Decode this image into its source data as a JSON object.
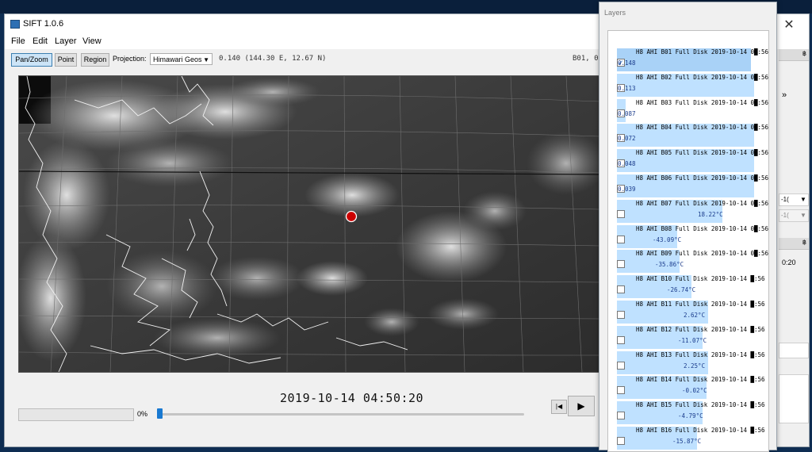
{
  "window": {
    "title": "SIFT 1.0.6",
    "close_glyph": "✕"
  },
  "menu": [
    "File",
    "Edit",
    "Layer",
    "View"
  ],
  "toolbar": {
    "tools": [
      "Pan/Zoom",
      "Point",
      "Region"
    ],
    "active_tool": "Pan/Zoom",
    "projection_label": "Projection:",
    "projection_value": "Himawari Geos",
    "cursor_readout": "0.140 (144.30 E,  12.67 N)",
    "band_readout": "B01, 0"
  },
  "animation": {
    "timestamp": "2019-10-14 04:50:20",
    "progress_percent_label": "0%",
    "progress": 0,
    "first_button_icon": "skip-to-first-icon",
    "play_button_icon": "play-icon"
  },
  "layers_panel": {
    "title": "Layers",
    "rows": [
      {
        "name": "H8 AHI B01 Full Disk 2019-10-14 0█:56",
        "value": "0.148",
        "checked": true,
        "bar_fraction": 0.94
      },
      {
        "name": "H8 AHI B02 Full Disk 2019-10-14 0█:56",
        "value": "0.113",
        "checked": false,
        "bar_fraction": 0.96
      },
      {
        "name": "H8 AHI B03 Full Disk 2019-10-14 0█:56",
        "value": "0.087",
        "checked": false,
        "bar_fraction": 0.06
      },
      {
        "name": "H8 AHI B04 Full Disk 2019-10-14 0█:56",
        "value": "0.072",
        "checked": false,
        "bar_fraction": 0.96
      },
      {
        "name": "H8 AHI B05 Full Disk 2019-10-14 0█:56",
        "value": "0.048",
        "checked": false,
        "bar_fraction": 0.96
      },
      {
        "name": "H8 AHI B06 Full Disk 2019-10-14 0█:56",
        "value": "0.039",
        "checked": false,
        "bar_fraction": 0.96
      },
      {
        "name": "H8 AHI B07 Full Disk 2019-10-14 0█:56",
        "value": "18.22°C",
        "checked": false,
        "bar_fraction": 0.74
      },
      {
        "name": "H8 AHI B08 Full Disk 2019-10-14 0█:56",
        "value": "-43.09°C",
        "checked": false,
        "bar_fraction": 0.42
      },
      {
        "name": "H8 AHI B09 Full Disk 2019-10-14 0█:56",
        "value": "-35.86°C",
        "checked": false,
        "bar_fraction": 0.44
      },
      {
        "name": "H8 AHI B10 Full Disk 2019-10-14 █:56",
        "value": "-26.74°C",
        "checked": false,
        "bar_fraction": 0.52
      },
      {
        "name": "H8 AHI B11 Full Disk 2019-10-14 █:56",
        "value": "2.62°C",
        "checked": false,
        "bar_fraction": 0.64
      },
      {
        "name": "H8 AHI B12 Full Disk 2019-10-14 █:56",
        "value": "-11.07°C",
        "checked": false,
        "bar_fraction": 0.6
      },
      {
        "name": "H8 AHI B13 Full Disk 2019-10-14 █:56",
        "value": "2.25°C",
        "checked": false,
        "bar_fraction": 0.64
      },
      {
        "name": "H8 AHI B14 Full Disk 2019-10-14 █:56",
        "value": "-0.02°C",
        "checked": false,
        "bar_fraction": 0.63
      },
      {
        "name": "H8 AHI B15 Full Disk 2019-10-14 █:56",
        "value": "-4.79°C",
        "checked": false,
        "bar_fraction": 0.6
      },
      {
        "name": "H8 AHI B16 Full Disk 2019-10-14 █:56",
        "value": "-15.87°C",
        "checked": false,
        "bar_fraction": 0.56
      }
    ]
  },
  "dock": {
    "float_glyph": "฿",
    "pin_glyph": "θ",
    "expand_glyph": "»",
    "combo1": "-1(",
    "combo2": "-1(",
    "time_snippet": "0:20"
  },
  "colors": {
    "active_tool": "#cce4f7",
    "layer_bar": "#bfe1ff",
    "slider_handle": "#1979d1",
    "probe_marker": "#cc0000"
  }
}
